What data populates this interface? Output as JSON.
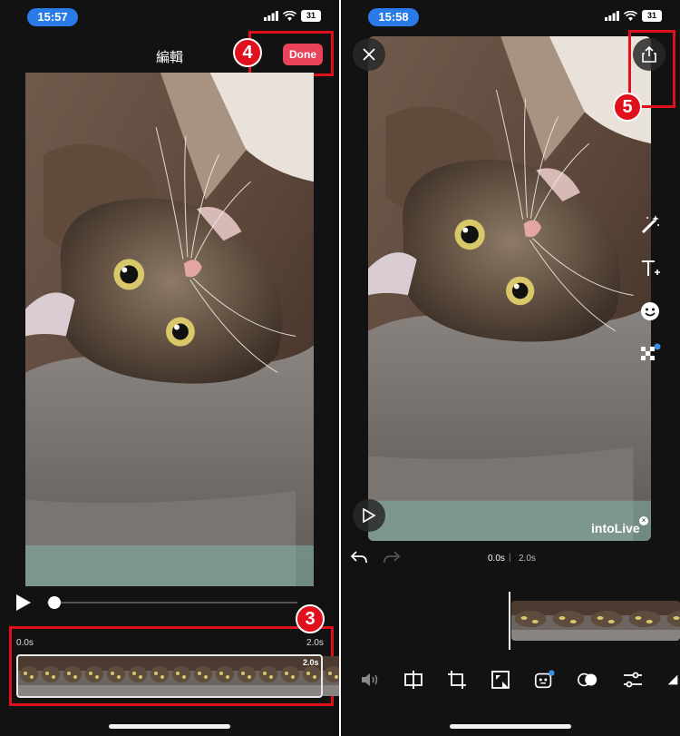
{
  "colors": {
    "accent_red": "#e0101c",
    "done_pink": "#e8435a",
    "time_pill_blue": "#2a7ae8",
    "background": "#121212"
  },
  "left": {
    "status_time": "15:57",
    "battery": "31",
    "title": "編輯",
    "done_label": "Done",
    "step_a": "4",
    "step_b": "3",
    "trim_start": "0.0s",
    "trim_end": "2.0s",
    "clip_duration": "2.0s",
    "icons": [
      "signal-icon",
      "wifi-icon",
      "play-icon"
    ]
  },
  "right": {
    "status_time": "15:58",
    "battery": "31",
    "step_c": "5",
    "watermark": "intoLive",
    "time_current": "0.0s",
    "time_separator": "|",
    "time_total": "2.0s",
    "icons": [
      "close-icon",
      "share-icon",
      "magic-wand-icon",
      "text-icon",
      "sticker-icon",
      "mosaic-icon",
      "play-icon",
      "undo-icon",
      "redo-icon",
      "volume-icon",
      "split-icon",
      "crop-icon",
      "resize-icon",
      "ai-face-icon",
      "filter-icon",
      "adjust-icon",
      "more-tools-icon"
    ]
  }
}
